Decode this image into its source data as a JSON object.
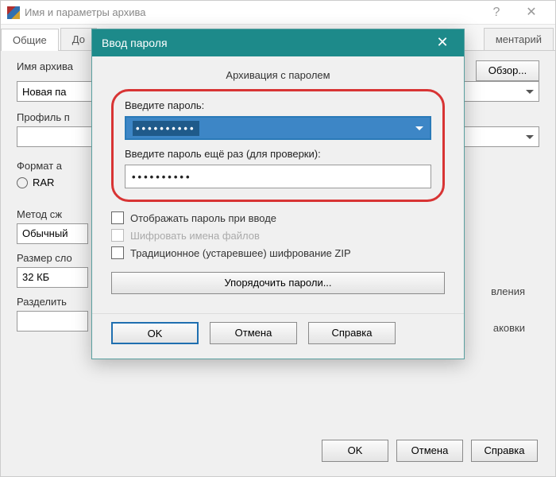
{
  "parent": {
    "title": "Имя и параметры архива",
    "tabs": {
      "general": "Общие",
      "additional": "До",
      "comment": "ментарий"
    },
    "labels": {
      "archive_name": "Имя архива",
      "profile": "Профиль п",
      "format": "Формат а",
      "method": "Метод сж",
      "dict_size": "Размер сло",
      "split": "Разделить",
      "update": "вления",
      "packing": "аковки"
    },
    "values": {
      "archive_name": "Новая па",
      "method": "Обычный",
      "dict_size": "32 КБ",
      "format_rar": "RAR"
    },
    "buttons": {
      "browse": "Обзор...",
      "ok": "OK",
      "cancel": "Отмена",
      "help": "Справка"
    }
  },
  "modal": {
    "title": "Ввод пароля",
    "subtitle": "Архивация с паролем",
    "labels": {
      "enter": "Введите пароль:",
      "confirm": "Введите пароль ещё раз (для проверки):",
      "show": "Отображать пароль при вводе",
      "encrypt_names": "Шифровать имена файлов",
      "legacy_zip": "Традиционное (устаревшее) шифрование ZIP",
      "organize": "Упорядочить пароли..."
    },
    "values": {
      "pw1": "••••••••••",
      "pw2": "••••••••••"
    },
    "buttons": {
      "ok": "OK",
      "cancel": "Отмена",
      "help": "Справка"
    }
  }
}
